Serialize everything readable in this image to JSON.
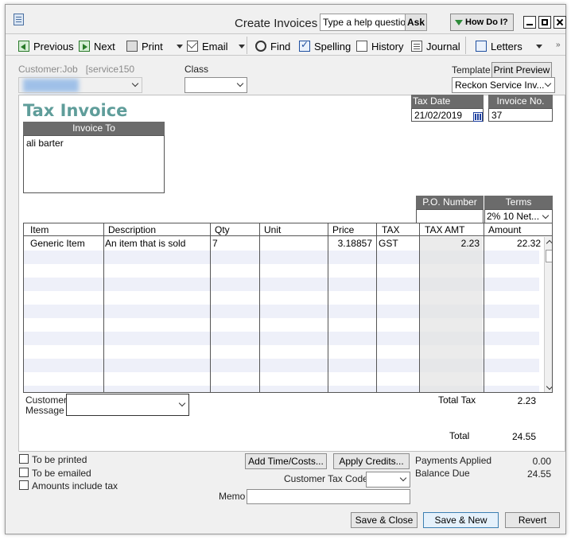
{
  "window": {
    "title": "Create Invoices",
    "help_placeholder": "Type a help question",
    "ask_label": "Ask",
    "howdoi_label": "How Do I?"
  },
  "toolbar": {
    "previous": "Previous",
    "next": "Next",
    "print": "Print",
    "email": "Email",
    "find": "Find",
    "spelling": "Spelling",
    "history": "History",
    "journal": "Journal",
    "letters": "Letters"
  },
  "header": {
    "customer_label": "Customer:Job",
    "customer_value": "[service150",
    "class_label": "Class",
    "class_value": "",
    "template_label": "Template",
    "print_preview": "Print Preview",
    "template_value": "Reckon Service Inv..."
  },
  "invoice": {
    "title": "Tax Invoice",
    "invoice_to_label": "Invoice To",
    "invoice_to_value": "ali barter",
    "tax_date_label": "Tax Date",
    "tax_date_value": "21/02/2019",
    "invoice_no_label": "Invoice No.",
    "invoice_no_value": "37",
    "po_label": "P.O. Number",
    "po_value": "",
    "terms_label": "Terms",
    "terms_value": "2% 10 Net..."
  },
  "grid": {
    "columns": [
      "Item",
      "Description",
      "Qty",
      "Unit",
      "Price",
      "TAX",
      "TAX AMT",
      "Amount"
    ],
    "rows": [
      {
        "item": "Generic Item",
        "description": "An item that is sold",
        "qty": "7",
        "unit": "",
        "price": "3.18857",
        "tax": "GST",
        "tax_amt": "2.23",
        "amount": "22.32"
      }
    ]
  },
  "footer": {
    "customer_message_label_1": "Customer",
    "customer_message_label_2": "Message",
    "total_tax_label": "Total Tax",
    "total_tax_value": "2.23",
    "total_label": "Total",
    "total_value": "24.55",
    "to_be_printed": "To be printed",
    "to_be_emailed": "To be emailed",
    "amounts_include_tax": "Amounts include tax",
    "add_time_costs": "Add Time/Costs...",
    "apply_credits": "Apply Credits...",
    "payments_applied_label": "Payments Applied",
    "payments_applied_value": "0.00",
    "balance_due_label": "Balance Due",
    "balance_due_value": "24.55",
    "customer_tax_code_label": "Customer Tax Code",
    "memo_label": "Memo",
    "save_close": "Save & Close",
    "save_new": "Save & New",
    "revert": "Revert"
  }
}
